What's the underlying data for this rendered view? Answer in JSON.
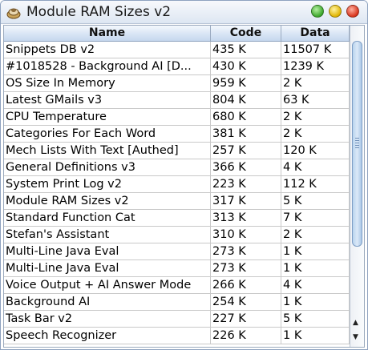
{
  "window": {
    "title": "Module RAM Sizes v2"
  },
  "table": {
    "columns": [
      "Name",
      "Code",
      "Data"
    ],
    "rows": [
      [
        "Snippets DB v2",
        "435 K",
        "11507 K"
      ],
      [
        "#1018528 - Background AI [D...",
        "430 K",
        "1239 K"
      ],
      [
        "OS Size In Memory",
        "959 K",
        "2 K"
      ],
      [
        "Latest GMails v3",
        "804 K",
        "63 K"
      ],
      [
        "CPU Temperature",
        "680 K",
        "2 K"
      ],
      [
        "Categories For Each Word",
        "381 K",
        "2 K"
      ],
      [
        "Mech Lists With Text [Authed]",
        "257 K",
        "120 K"
      ],
      [
        "General Definitions v3",
        "366 K",
        "4 K"
      ],
      [
        "System Print Log v2",
        "223 K",
        "112 K"
      ],
      [
        "Module RAM Sizes v2",
        "317 K",
        "5 K"
      ],
      [
        "Standard Function Cat",
        "313 K",
        "7 K"
      ],
      [
        "Stefan's Assistant",
        "310 K",
        "2 K"
      ],
      [
        "Multi-Line Java Eval",
        "273 K",
        "1 K"
      ],
      [
        "Multi-Line Java Eval",
        "273 K",
        "1 K"
      ],
      [
        "Voice Output + AI Answer Mode",
        "266 K",
        "4 K"
      ],
      [
        "Background AI",
        "254 K",
        "1 K"
      ],
      [
        "Task Bar v2",
        "227 K",
        "5 K"
      ],
      [
        "Speech Recognizer",
        "226 K",
        "1 K"
      ]
    ]
  },
  "scrollbar": {
    "up_arrow": "▲",
    "down_arrow": "▼",
    "up_icon": "arrow-up-icon",
    "down_icon": "arrow-down-icon"
  },
  "colors": {
    "thumb": "#c6dcf2",
    "header": "#d8e5f5",
    "close": "#d8341c",
    "minimize": "#e0b400",
    "maximize": "#3aa62a"
  }
}
